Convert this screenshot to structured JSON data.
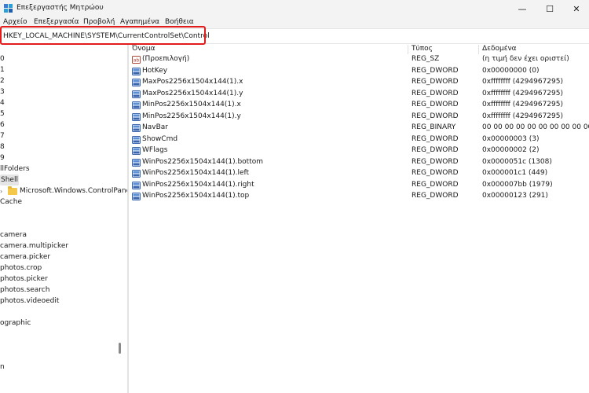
{
  "window": {
    "title": "Επεξεργαστής Μητρώου",
    "minimize": "—",
    "maximize": "☐",
    "close": "✕"
  },
  "menu": [
    "Αρχείο",
    "Επεξεργασία",
    "Προβολή",
    "Αγαπημένα",
    "Βοήθεια"
  ],
  "address": {
    "path": "HKEY_LOCAL_MACHINE\\SYSTEM\\CurrentControlSet\\Control"
  },
  "tree": {
    "items": [
      {
        "label": "0"
      },
      {
        "label": "1"
      },
      {
        "label": "2"
      },
      {
        "label": "3"
      },
      {
        "label": "4"
      },
      {
        "label": "5"
      },
      {
        "label": "6"
      },
      {
        "label": "7"
      },
      {
        "label": "8"
      },
      {
        "label": "9"
      },
      {
        "label": "llFolders"
      },
      {
        "label": "Shell"
      },
      {
        "label": "Microsoft.Windows.ControlPanel"
      },
      {
        "label": "Cache"
      },
      {
        "label": "camera"
      },
      {
        "label": "camera.multipicker"
      },
      {
        "label": "camera.picker"
      },
      {
        "label": "photos.crop"
      },
      {
        "label": "photos.picker"
      },
      {
        "label": "photos.search"
      },
      {
        "label": "photos.videoedit"
      },
      {
        "label": "ographic"
      },
      {
        "label": "n"
      }
    ]
  },
  "list": {
    "headers": {
      "name": "Όνομα",
      "type": "Τύπος",
      "data": "Δεδομένα"
    },
    "rows": [
      {
        "icon": "string-value-icon",
        "name": "(Προεπιλογή)",
        "type": "REG_SZ",
        "data": "(η τιμή δεν έχει οριστεί)"
      },
      {
        "icon": "binary-value-icon",
        "name": "HotKey",
        "type": "REG_DWORD",
        "data": "0x00000000 (0)"
      },
      {
        "icon": "binary-value-icon",
        "name": "MaxPos2256x1504x144(1).x",
        "type": "REG_DWORD",
        "data": "0xffffffff (4294967295)"
      },
      {
        "icon": "binary-value-icon",
        "name": "MaxPos2256x1504x144(1).y",
        "type": "REG_DWORD",
        "data": "0xffffffff (4294967295)"
      },
      {
        "icon": "binary-value-icon",
        "name": "MinPos2256x1504x144(1).x",
        "type": "REG_DWORD",
        "data": "0xffffffff (4294967295)"
      },
      {
        "icon": "binary-value-icon",
        "name": "MinPos2256x1504x144(1).y",
        "type": "REG_DWORD",
        "data": "0xffffffff (4294967295)"
      },
      {
        "icon": "binary-value-icon",
        "name": "NavBar",
        "type": "REG_BINARY",
        "data": "00 00 00 00 00 00 00 00 00 00 00"
      },
      {
        "icon": "binary-value-icon",
        "name": "ShowCmd",
        "type": "REG_DWORD",
        "data": "0x00000003 (3)"
      },
      {
        "icon": "binary-value-icon",
        "name": "WFlags",
        "type": "REG_DWORD",
        "data": "0x00000002 (2)"
      },
      {
        "icon": "binary-value-icon",
        "name": "WinPos2256x1504x144(1).bottom",
        "type": "REG_DWORD",
        "data": "0x0000051c (1308)"
      },
      {
        "icon": "binary-value-icon",
        "name": "WinPos2256x1504x144(1).left",
        "type": "REG_DWORD",
        "data": "0x000001c1 (449)"
      },
      {
        "icon": "binary-value-icon",
        "name": "WinPos2256x1504x144(1).right",
        "type": "REG_DWORD",
        "data": "0x000007bb (1979)"
      },
      {
        "icon": "binary-value-icon",
        "name": "WinPos2256x1504x144(1).top",
        "type": "REG_DWORD",
        "data": "0x00000123 (291)"
      }
    ]
  },
  "colors": {
    "highlight": "#e21b1b",
    "selection": "#e5e5e5",
    "folder": "#f4c94b"
  }
}
